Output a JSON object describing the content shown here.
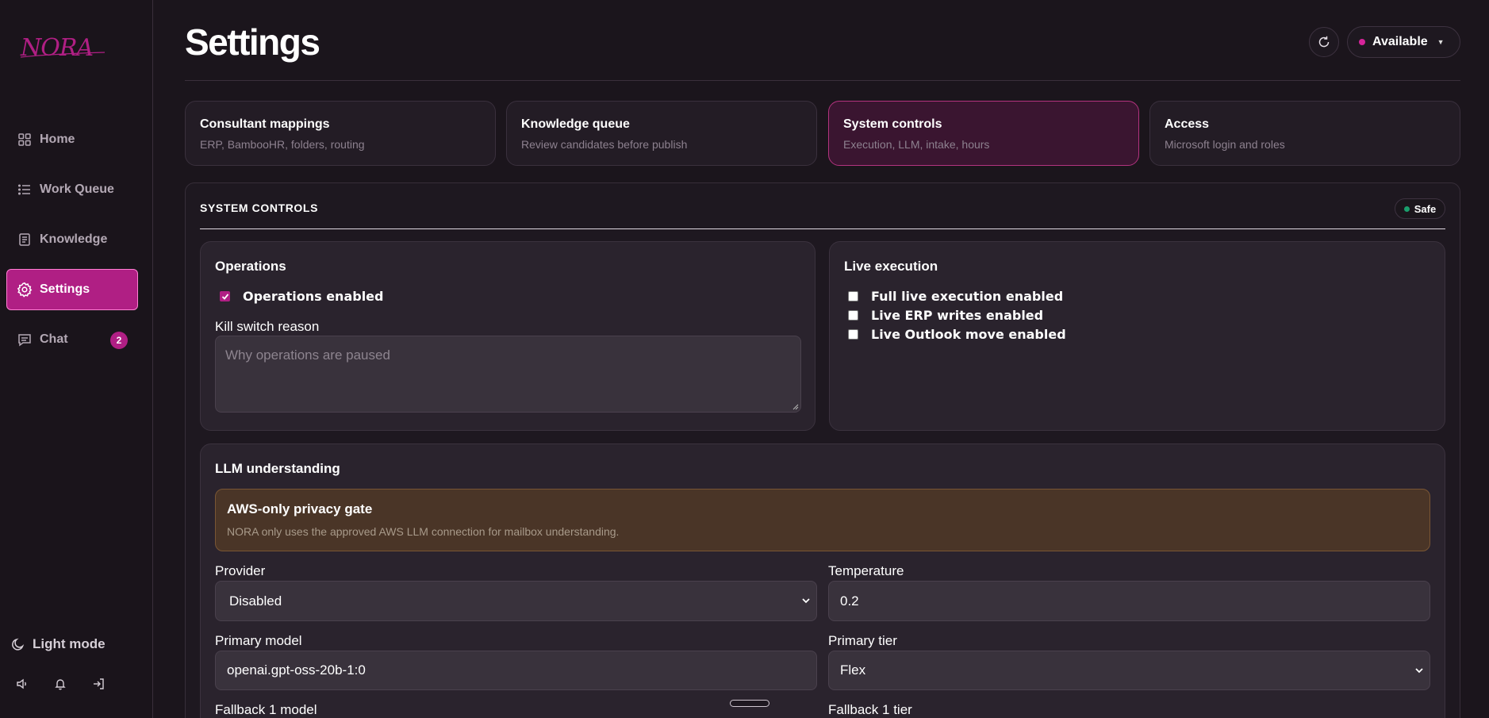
{
  "app": {
    "logo_text": "NORA"
  },
  "sidebar": {
    "items": [
      {
        "label": "Home",
        "icon": "grid-icon"
      },
      {
        "label": "Work Queue",
        "icon": "list-icon"
      },
      {
        "label": "Knowledge",
        "icon": "book-icon"
      },
      {
        "label": "Settings",
        "icon": "gear-icon",
        "active": true
      },
      {
        "label": "Chat",
        "icon": "chat-icon",
        "badge": "2"
      }
    ],
    "light_mode_label": "Light mode",
    "footer_icons": [
      "speaker-icon",
      "bell-icon",
      "logout-icon"
    ]
  },
  "header": {
    "title": "Settings",
    "status_label": "Available"
  },
  "tabs": [
    {
      "title": "Consultant mappings",
      "subtitle": "ERP, BambooHR, folders, routing"
    },
    {
      "title": "Knowledge queue",
      "subtitle": "Review candidates before publish"
    },
    {
      "title": "System controls",
      "subtitle": "Execution, LLM, intake, hours",
      "active": true
    },
    {
      "title": "Access",
      "subtitle": "Microsoft login and roles"
    }
  ],
  "system_controls": {
    "section_title": "SYSTEM CONTROLS",
    "safe_badge": "Safe",
    "operations": {
      "title": "Operations",
      "operations_enabled_label": "Operations enabled",
      "operations_enabled": true,
      "kill_switch_label": "Kill switch reason",
      "kill_switch_placeholder": "Why operations are paused",
      "kill_switch_value": ""
    },
    "live_execution": {
      "title": "Live execution",
      "options": [
        {
          "label": "Full live execution enabled",
          "checked": false
        },
        {
          "label": "Live ERP writes enabled",
          "checked": false
        },
        {
          "label": "Live Outlook move enabled",
          "checked": false
        }
      ]
    },
    "llm": {
      "title": "LLM understanding",
      "privacy_title": "AWS-only privacy gate",
      "privacy_text": "NORA only uses the approved AWS LLM connection for mailbox understanding.",
      "provider_label": "Provider",
      "provider_value": "Disabled",
      "temperature_label": "Temperature",
      "temperature_value": "0.2",
      "primary_model_label": "Primary model",
      "primary_model_value": "openai.gpt-oss-20b-1:0",
      "primary_tier_label": "Primary tier",
      "primary_tier_value": "Flex",
      "fallback1_model_label": "Fallback 1 model",
      "fallback1_tier_label": "Fallback 1 tier"
    }
  },
  "colors": {
    "accent": "#b01f84",
    "background": "#1b151c",
    "card": "#2a232d",
    "safe_dot": "#1a9e6c",
    "privacy_bg": "#4a3527"
  }
}
